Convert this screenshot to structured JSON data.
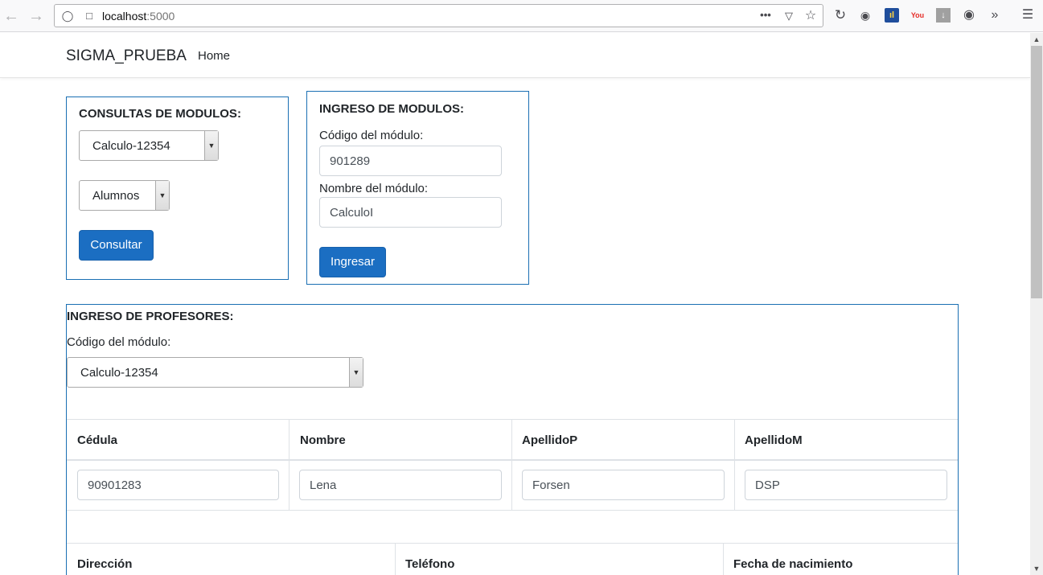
{
  "browser": {
    "url_host": "localhost",
    "url_port": ":5000",
    "icons": [
      "back-icon",
      "forward-icon",
      "shield-icon",
      "page-icon",
      "more-icon",
      "pocket-icon",
      "star-icon",
      "reload-icon",
      "extension-icon",
      "extension-icon",
      "youtube-icon",
      "download-icon",
      "account-icon",
      "overflow-icon",
      "menu-icon"
    ]
  },
  "navbar": {
    "brand": "SIGMA_PRUEBA",
    "home": "Home"
  },
  "consultas": {
    "title": "CONSULTAS DE MODULOS:",
    "modulo_selected": "Calculo-12354",
    "tipo_selected": "Alumnos",
    "button": "Consultar"
  },
  "ingreso_modulos": {
    "title": "INGRESO DE MODULOS:",
    "codigo_label": "Código del módulo:",
    "codigo_value": "901289",
    "nombre_label": "Nombre del módulo:",
    "nombre_value": "CalculoI",
    "button": "Ingresar"
  },
  "ingreso_profesores": {
    "title": "INGRESO DE PROFESORES:",
    "codigo_label": "Código del módulo:",
    "modulo_selected": "Calculo-12354",
    "table1": {
      "headers": [
        "Cédula",
        "Nombre",
        "ApellidoP",
        "ApellidoM"
      ],
      "values": [
        "90901283",
        "Lena",
        "Forsen",
        "DSP"
      ]
    },
    "table2": {
      "headers": [
        "Dirección",
        "Teléfono",
        "Fecha de nacimiento"
      ]
    }
  },
  "colors": {
    "accent": "#1b6ec2",
    "box_border": "#1a6fb3"
  }
}
